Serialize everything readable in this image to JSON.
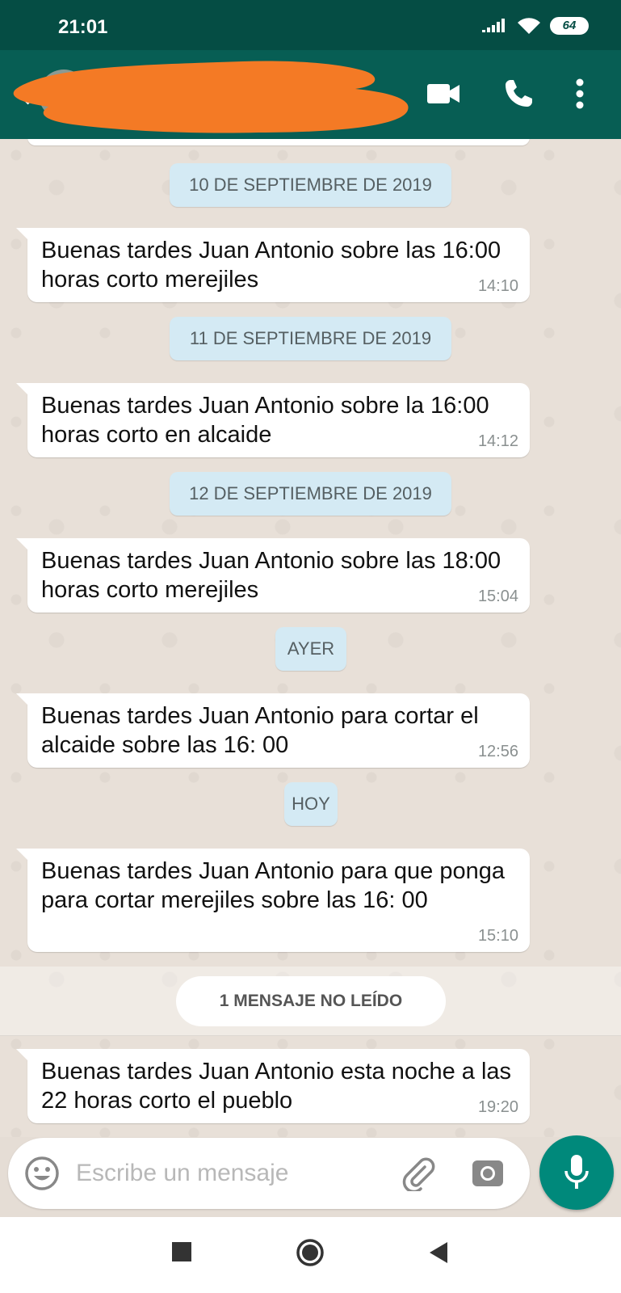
{
  "status_bar": {
    "time": "21:01",
    "battery": "64"
  },
  "header": {
    "contact_name": "",
    "icons": [
      "back-arrow-icon",
      "video-call-icon",
      "phone-icon",
      "more-options-icon"
    ]
  },
  "chat": {
    "date_chips": {
      "sep10": "10 DE SEPTIEMBRE DE 2019",
      "sep11": "11 DE SEPTIEMBRE DE 2019",
      "sep12": "12 DE SEPTIEMBRE DE 2019",
      "ayer": "AYER",
      "hoy": "HOY"
    },
    "messages": [
      {
        "text": "Buenas tardes Juan Antonio sobre las 16:00  horas  corto merejiles",
        "time": "14:10"
      },
      {
        "text": "Buenas tardes Juan Antonio sobre la 16:00 horas corto en alcaide",
        "time": "14:12"
      },
      {
        "text": "Buenas tardes Juan Antonio sobre las 18:00 horas corto merejiles",
        "time": "15:04"
      },
      {
        "text": "Buenas tardes Juan Antonio para cortar el alcaide sobre las 16: 00",
        "time": "12:56"
      },
      {
        "text": "Buenas tardes Juan Antonio para que ponga para cortar merejiles sobre las 16: 00",
        "time": "15:10"
      },
      {
        "text": "Buenas tardes Juan Antonio esta noche a las 22 horas corto el pueblo",
        "time": "19:20"
      }
    ],
    "unread_label": "1 MENSAJE NO LEÍDO"
  },
  "composer": {
    "placeholder": "Escribe un mensaje",
    "icons": [
      "emoji-icon",
      "attach-icon",
      "camera-icon",
      "mic-icon"
    ]
  },
  "colors": {
    "header": "#075e54",
    "status_bar": "#054d44",
    "mic_button": "#00897b",
    "date_chip": "#d4eaf4",
    "redaction": "#f47a25"
  }
}
